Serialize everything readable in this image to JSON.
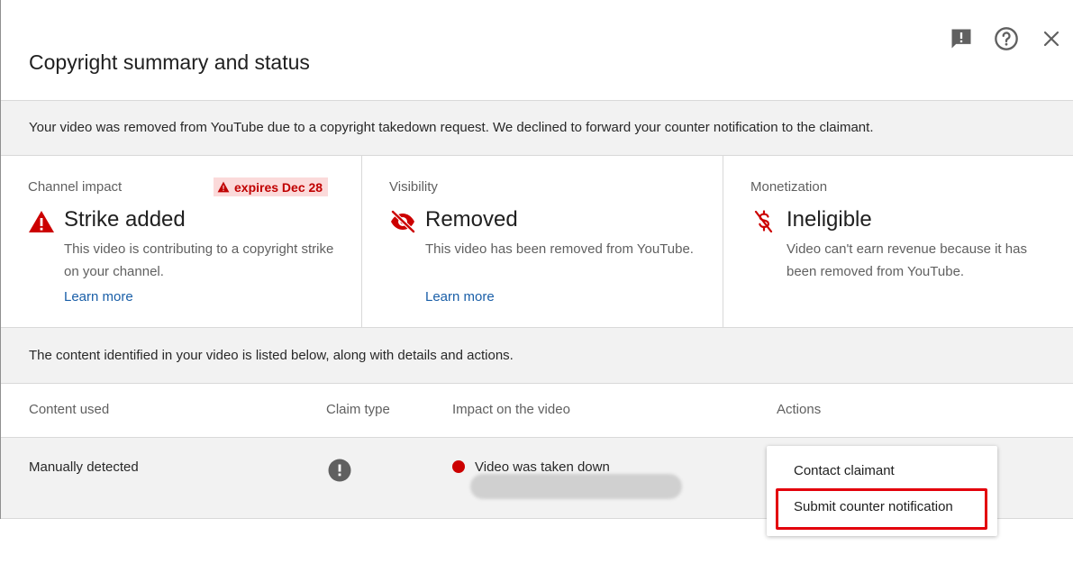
{
  "dialog": {
    "title": "Copyright summary and status",
    "icons": [
      "feedback-icon",
      "help-icon",
      "close-icon"
    ]
  },
  "notice": "Your video was removed from YouTube due to a copyright takedown request. We declined to forward your counter notification to the claimant.",
  "cards": {
    "channel_impact": {
      "label": "Channel impact",
      "badge": "expires Dec 28",
      "heading": "Strike added",
      "description": "This video is contributing to a copyright strike on your channel.",
      "link": "Learn more"
    },
    "visibility": {
      "label": "Visibility",
      "heading": "Removed",
      "description": "This video has been removed from YouTube.",
      "link": "Learn more"
    },
    "monetization": {
      "label": "Monetization",
      "heading": "Ineligible",
      "description": "Video can't earn revenue because it has been removed from YouTube."
    }
  },
  "content_note": "The content identified in your video is listed below, along with details and actions.",
  "table": {
    "headers": [
      "Content used",
      "Claim type",
      "Impact on the video",
      "Actions"
    ],
    "rows": [
      {
        "content_used": "Manually detected",
        "impact": "Video was taken down"
      }
    ]
  },
  "actions_menu": {
    "items": [
      "Contact claimant",
      "Submit counter notification"
    ]
  },
  "colors": {
    "alert_red": "#cc0000",
    "link_blue": "#1a5fa8",
    "badge_bg": "#fbdada",
    "highlight_border": "#e3000b"
  }
}
